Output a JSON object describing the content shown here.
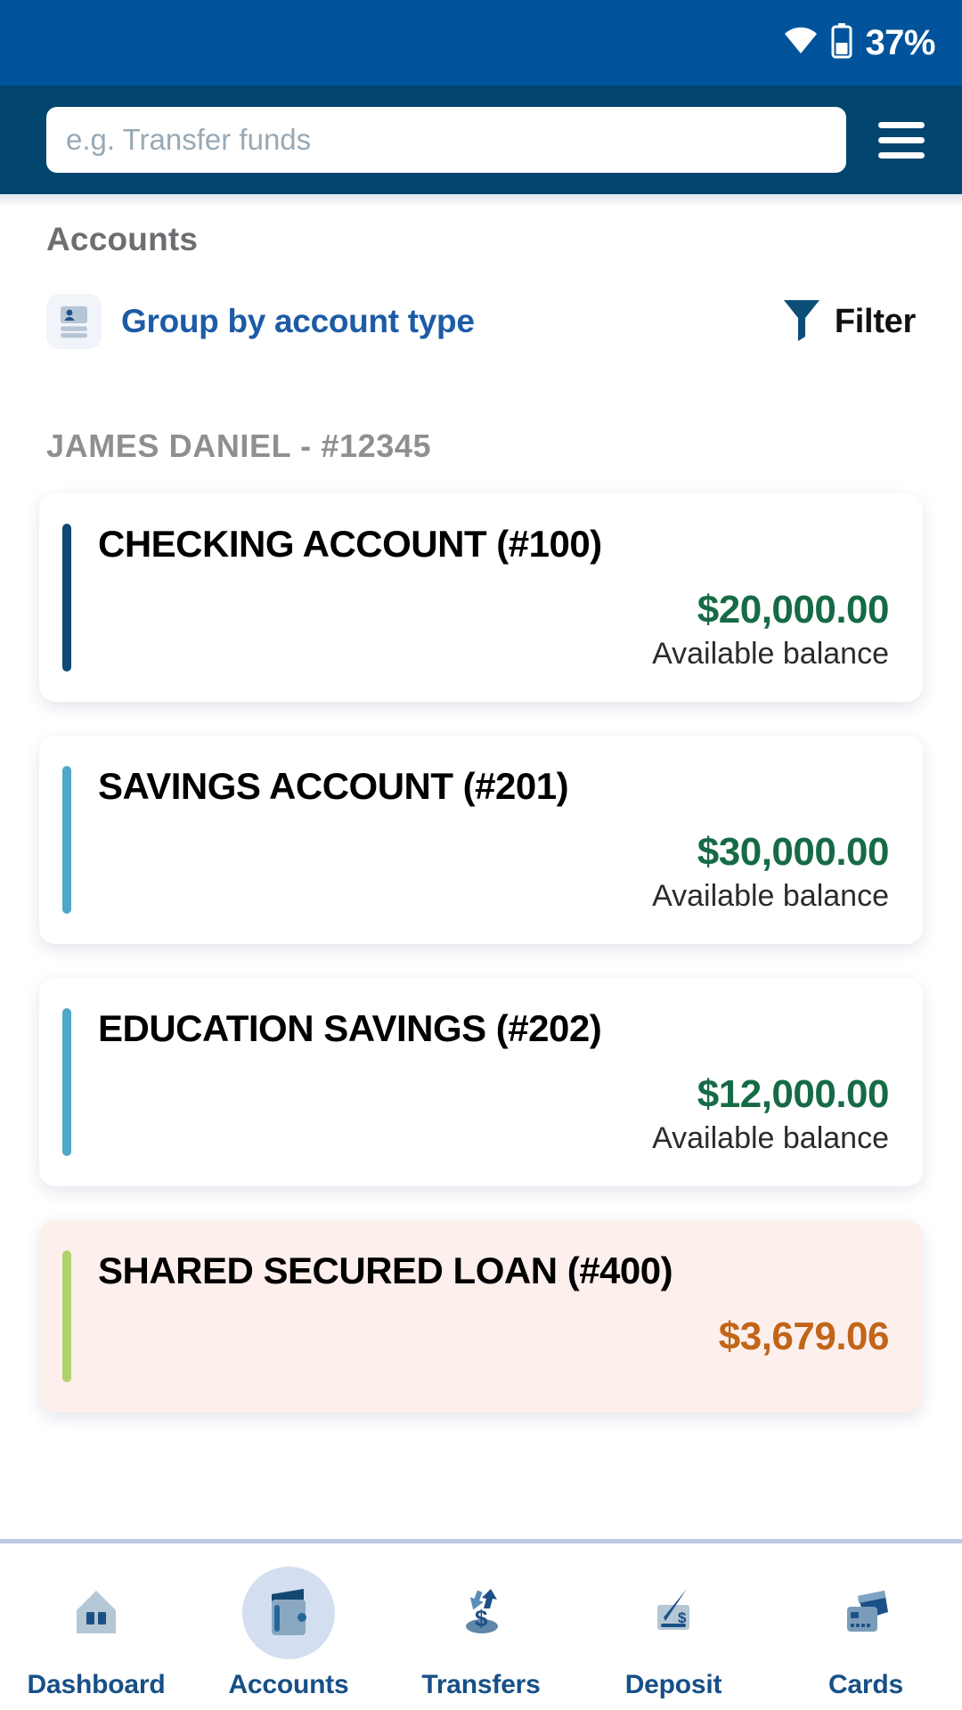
{
  "status_bar": {
    "battery_percent": "37%",
    "wifi_icon": "wifi-icon",
    "battery_icon": "battery-icon",
    "background_color": "#01549B"
  },
  "header": {
    "search_placeholder": "e.g. Transfer funds",
    "search_value": "",
    "menu_icon": "hamburger-menu-icon",
    "background_color": "#02456E"
  },
  "main": {
    "page_title": "Accounts",
    "toolbar": {
      "group_by_label": "Group by account type",
      "group_by_icon": "contact-card-icon",
      "group_by_color": "#1D5BA6",
      "filter_label": "Filter",
      "filter_icon": "funnel-filter-icon",
      "filter_icon_color": "#0C4E78"
    },
    "group_heading": "JAMES DANIEL - #12345",
    "accounts": [
      {
        "title": "CHECKING ACCOUNT (#100)",
        "amount": "$20,000.00",
        "caption": "Available balance",
        "accent_color": "#0E4A73",
        "amount_color": "#166B46",
        "card_background": "#ffffff",
        "amount_tone": "positive"
      },
      {
        "title": "SAVINGS ACCOUNT (#201)",
        "amount": "$30,000.00",
        "caption": "Available balance",
        "accent_color": "#4FA8C6",
        "amount_color": "#166B46",
        "card_background": "#ffffff",
        "amount_tone": "positive"
      },
      {
        "title": "EDUCATION SAVINGS (#202)",
        "amount": "$12,000.00",
        "caption": "Available balance",
        "accent_color": "#4FA8C6",
        "amount_color": "#166B46",
        "card_background": "#ffffff",
        "amount_tone": "positive"
      },
      {
        "title": "SHARED SECURED LOAN (#400)",
        "amount": "$3,679.06",
        "caption": "",
        "accent_color": "#AFD271",
        "amount_color": "#C16518",
        "card_background": "#FDEFEC",
        "amount_tone": "negative"
      }
    ]
  },
  "bottom_nav": {
    "active_index": 1,
    "items": [
      {
        "label": "Dashboard",
        "icon": "home-icon"
      },
      {
        "label": "Accounts",
        "icon": "wallet-icon"
      },
      {
        "label": "Transfers",
        "icon": "transfer-arrows-icon"
      },
      {
        "label": "Deposit",
        "icon": "check-deposit-icon"
      },
      {
        "label": "Cards",
        "icon": "credit-cards-icon"
      }
    ]
  }
}
